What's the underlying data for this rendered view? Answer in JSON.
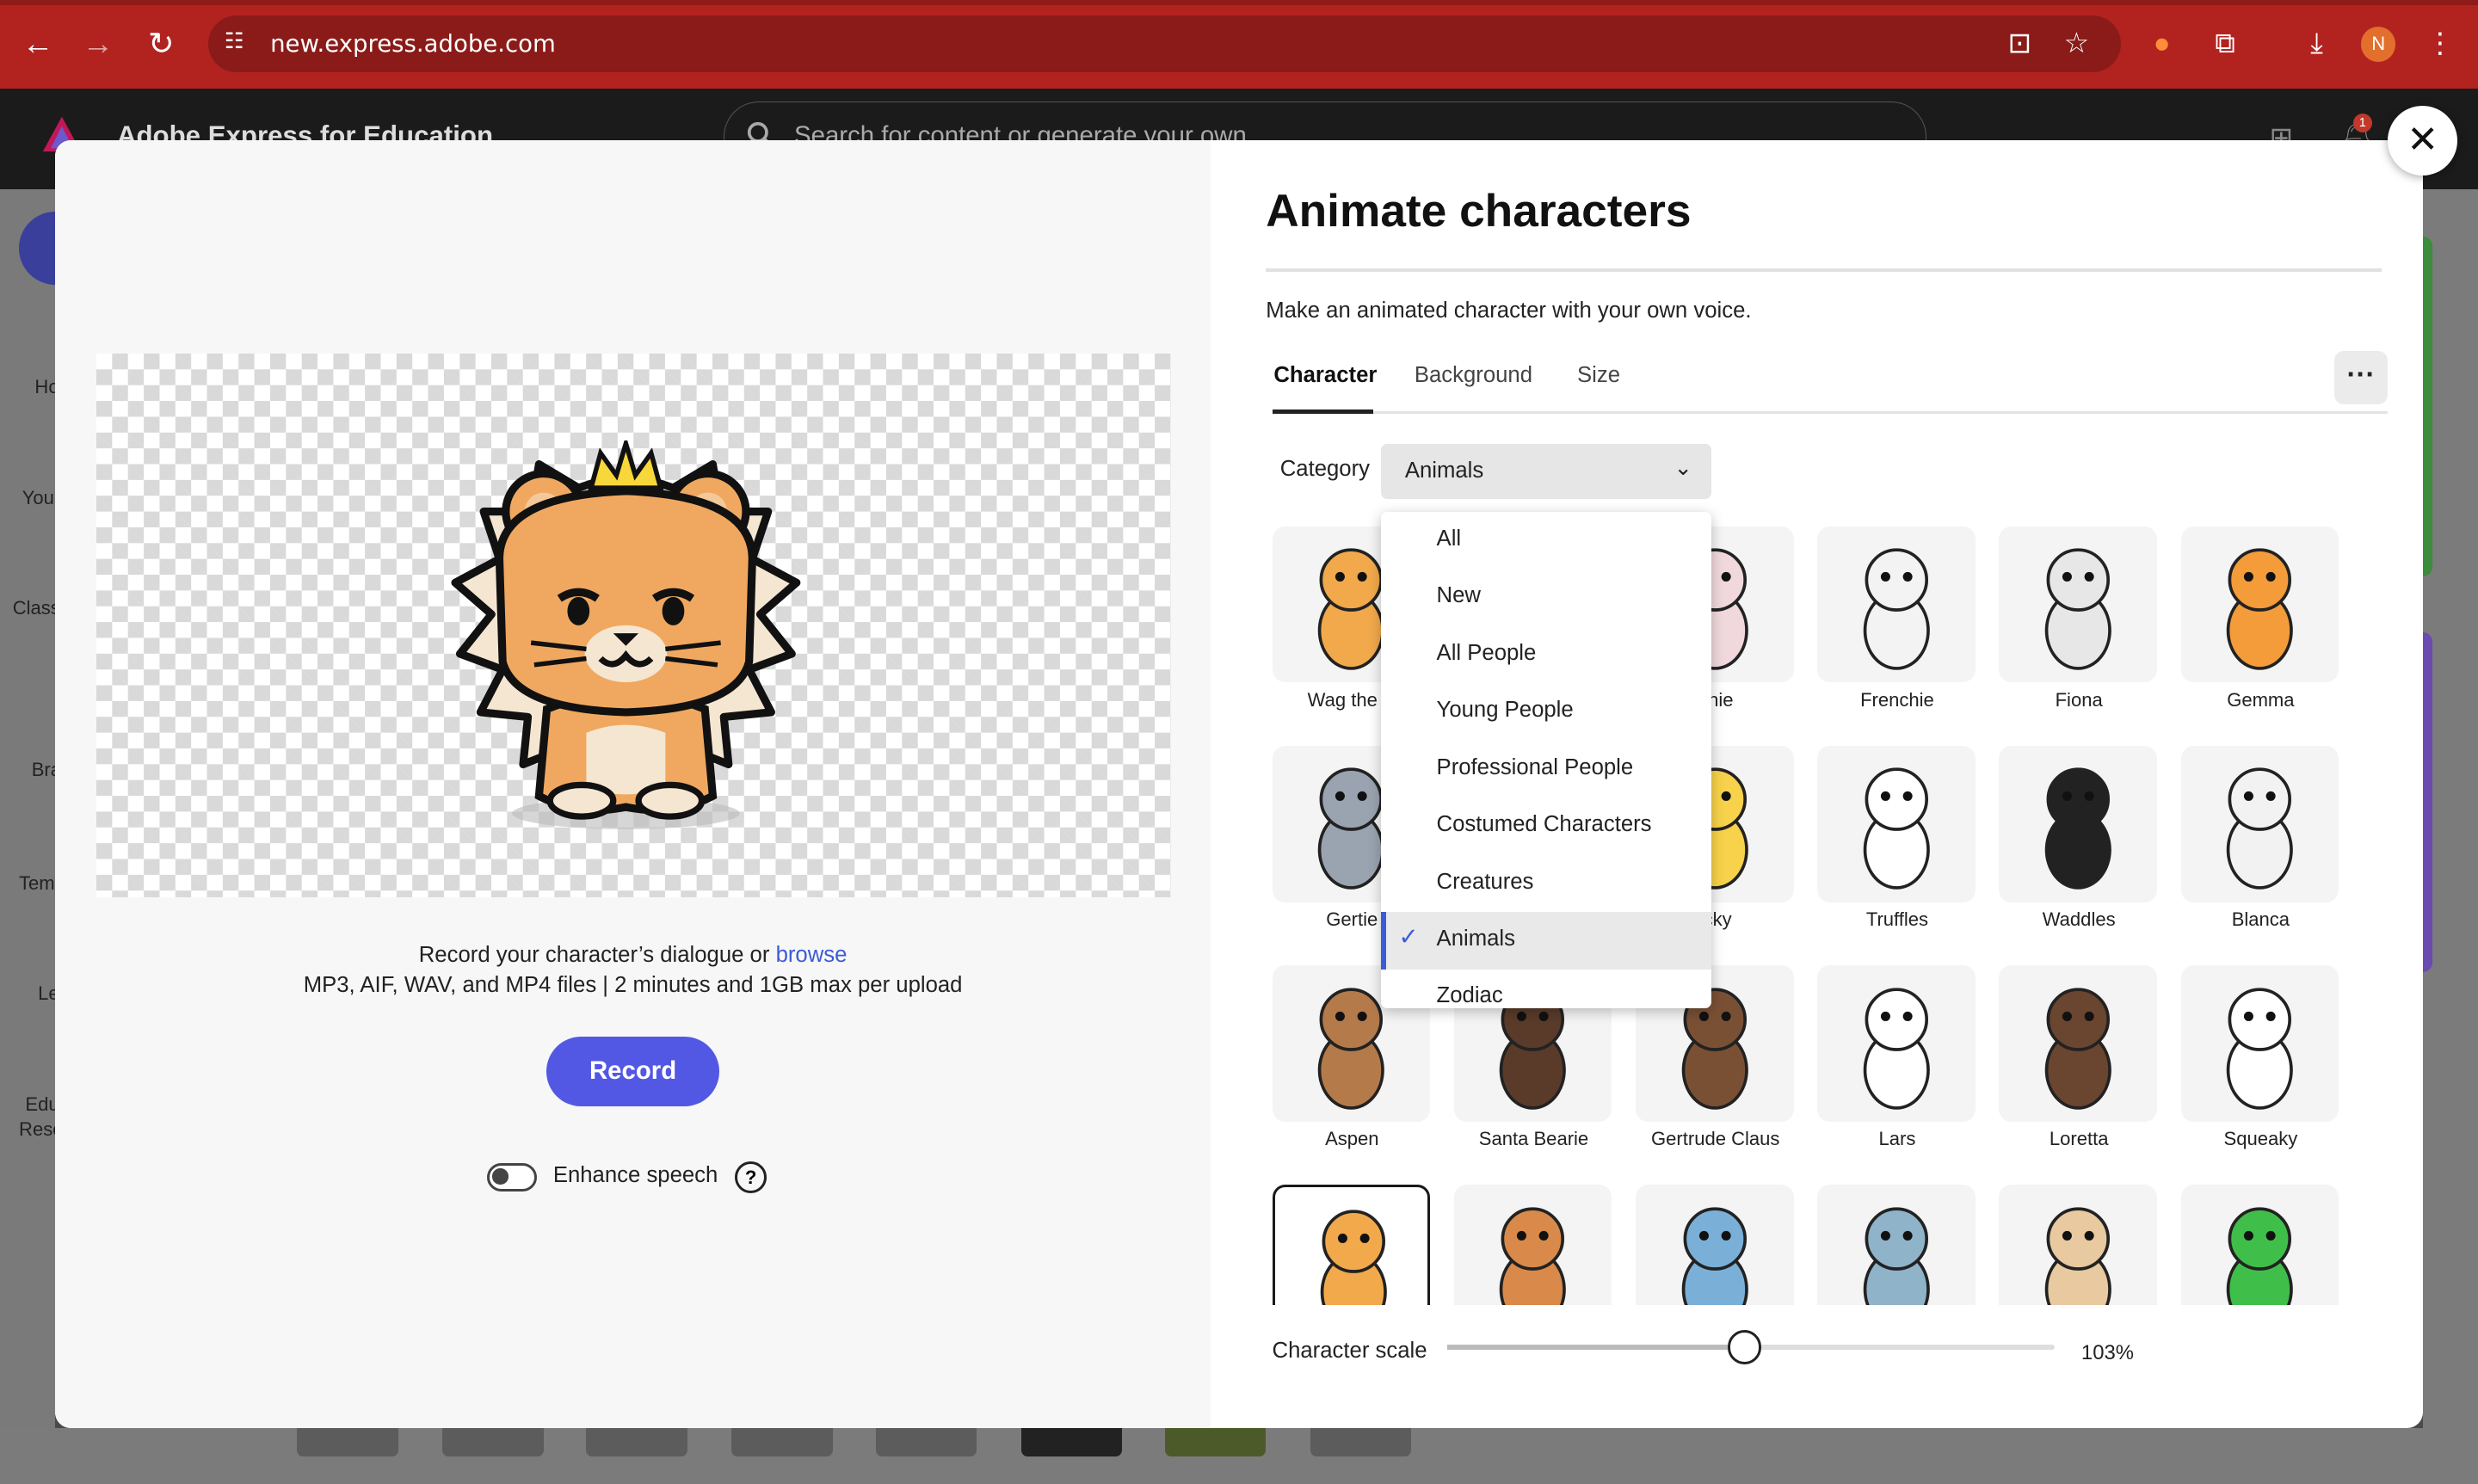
{
  "browser": {
    "url": "new.express.adobe.com",
    "profile_initial": "N",
    "notification_count": "1"
  },
  "app": {
    "brand": "Adobe Express for Education",
    "search_placeholder": "Search for content or generate your own",
    "rail": [
      "Ho",
      "You",
      "Class",
      "Bra",
      "Tem",
      "Le",
      "Edu",
      "Reso"
    ]
  },
  "modal": {
    "title": "Animate characters",
    "description": "Make an animated character with your own voice.",
    "tabs": [
      "Character",
      "Background",
      "Size"
    ],
    "active_tab": "Character",
    "record_line1": "Record your character’s dialogue or",
    "browse_link": "browse",
    "record_line2": "MP3, AIF, WAV, and MP4 files | 2 minutes and 1GB max per upload",
    "record_button": "Record",
    "enhance_label": "Enhance speech",
    "enhance_on": false,
    "category_label": "Category",
    "category_value": "Animals",
    "category_options": [
      "All",
      "New",
      "All People",
      "Young People",
      "Professional People",
      "Costumed Characters",
      "Creatures",
      "Animals",
      "Zodiac"
    ],
    "scale_label": "Character scale",
    "scale_value": "103%",
    "scale_level": 0.49
  },
  "characters": [
    {
      "name": "Wag the C",
      "color": "#f2a94b"
    },
    {
      "name": "",
      "color": "#eeeeee"
    },
    {
      "name": "nnie",
      "color": "#f0d8dc"
    },
    {
      "name": "Frenchie",
      "color": "#f3f3f3"
    },
    {
      "name": "Fiona",
      "color": "#e7e7e7"
    },
    {
      "name": "Gemma",
      "color": "#f49b3a"
    },
    {
      "name": "Gertie",
      "color": "#9aa4b0"
    },
    {
      "name": "",
      "color": "#eeeeee"
    },
    {
      "name": "icky",
      "color": "#f7d24a"
    },
    {
      "name": "Truffles",
      "color": "#ffffff"
    },
    {
      "name": "Waddles",
      "color": "#222222"
    },
    {
      "name": "Blanca",
      "color": "#f2f2f2"
    },
    {
      "name": "Aspen",
      "color": "#b57a4a"
    },
    {
      "name": "Santa Bearie",
      "color": "#5a3b2a"
    },
    {
      "name": "Gertrude Claus",
      "color": "#7a5035"
    },
    {
      "name": "Lars",
      "color": "#ffffff"
    },
    {
      "name": "Loretta",
      "color": "#6a4530"
    },
    {
      "name": "Squeaky",
      "color": "#ffffff"
    },
    {
      "name": "",
      "color": "#f2a94b"
    },
    {
      "name": "",
      "color": "#d98a4a"
    },
    {
      "name": "",
      "color": "#7ab0d8"
    },
    {
      "name": "",
      "color": "#8fb3c8"
    },
    {
      "name": "",
      "color": "#e8c9a0"
    },
    {
      "name": "",
      "color": "#3fbf4a"
    }
  ],
  "selected_character_index": 18
}
